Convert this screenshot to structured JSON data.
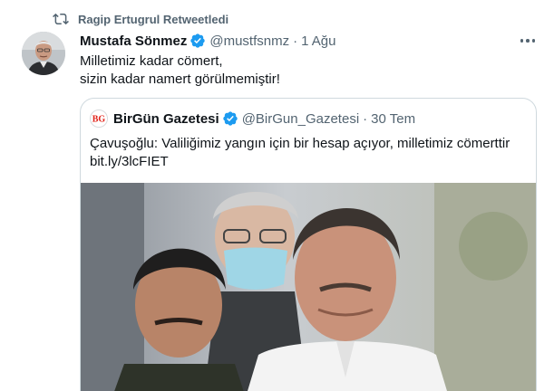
{
  "retweet": {
    "text": "Ragip Ertugrul Retweetledi"
  },
  "tweet": {
    "author_name": "Mustafa Sönmez",
    "handle": "@mustfsnmz",
    "separator": "·",
    "date": "1 Ağu",
    "text_line1": "Milletimiz kadar cömert,",
    "text_line2": "sizin kadar namert görülmemiştir!"
  },
  "quote": {
    "author_name": "BirGün Gazetesi",
    "handle": "@BirGun_Gazetesi",
    "separator": "·",
    "date": "30 Tem",
    "text_line1": "Çavuşoğlu: Valiliğimiz yangın için bir hesap açıyor, milletimiz cömerttir",
    "text_line2": "bit.ly/3lcFIET"
  },
  "colors": {
    "verified": "#1d9bf0",
    "muted": "#536471",
    "border": "#cfd9de",
    "logo_red": "#e2231a"
  },
  "icons": {
    "retweet": "retweet-icon",
    "verified": "verified-badge-icon",
    "more": "more-options-icon"
  }
}
